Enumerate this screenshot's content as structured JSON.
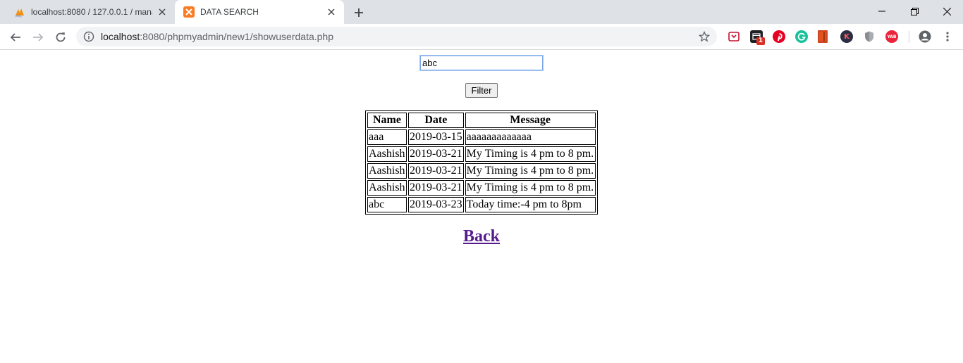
{
  "browser": {
    "tabs": [
      {
        "title": "localhost:8080 / 127.0.0.1 / mana",
        "icon": "phpmyadmin-icon",
        "active": false
      },
      {
        "title": "DATA SEARCH",
        "icon": "xampp-icon",
        "active": true
      }
    ],
    "url": {
      "host": "localhost",
      "rest": ":8080/phpmyadmin/new1/showuserdata.php"
    },
    "extension_badge": "1",
    "extension_yab_label": "YAB",
    "extension_k_label": "K"
  },
  "page": {
    "search_value": "abc",
    "filter_label": "Filter",
    "table": {
      "headers": [
        "Name",
        "Date",
        "Message"
      ],
      "rows": [
        [
          "aaa",
          "2019-03-15",
          "aaaaaaaaaaaaa"
        ],
        [
          "Aashish",
          "2019-03-21",
          "My Timing is 4 pm to 8 pm."
        ],
        [
          "Aashish",
          "2019-03-21",
          "My Timing is 4 pm to 8 pm."
        ],
        [
          "Aashish",
          "2019-03-21",
          "My Timing is 4 pm to 8 pm."
        ],
        [
          "abc",
          "2019-03-23",
          "Today time:-4 pm to 8pm"
        ]
      ]
    },
    "back_label": "Back"
  },
  "colors": {
    "tabstrip": "#dee1e6",
    "omnibox": "#f1f3f4",
    "link_visited": "#551a8b",
    "input_focus": "#7aa7e8"
  }
}
